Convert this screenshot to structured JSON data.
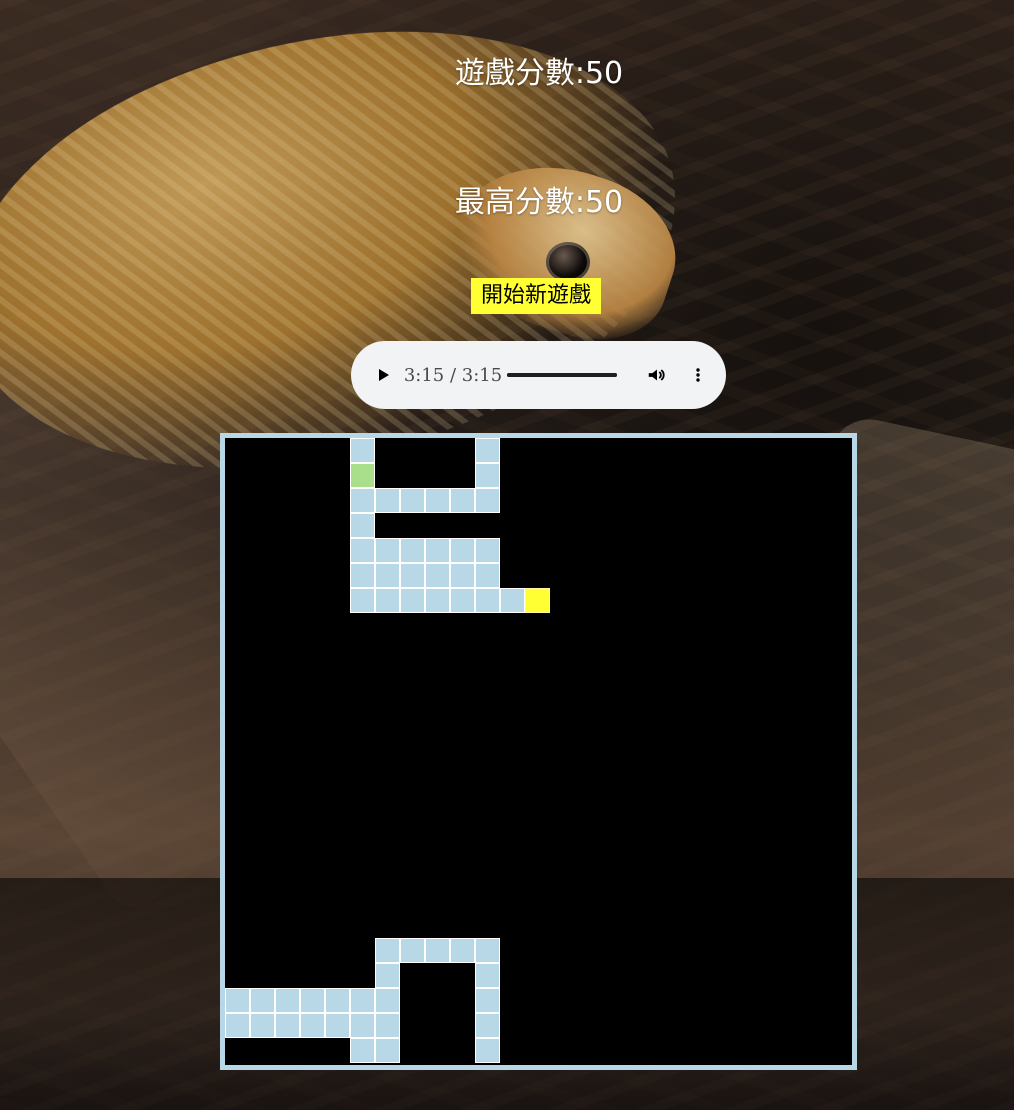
{
  "header": {
    "game_score_text": "遊戲分數:50",
    "high_score_text": "最高分數:50"
  },
  "controls": {
    "new_game_label": "開始新遊戲"
  },
  "audio": {
    "time_text": "3:15 / 3:15",
    "progress_ratio": 1,
    "icons": {
      "play": "play-icon",
      "volume": "volume-icon",
      "more": "more-vertical-icon"
    }
  },
  "game": {
    "grid": {
      "cols": 25,
      "rows": 25
    },
    "snake_cells": [
      [
        5,
        0
      ],
      [
        5,
        1
      ],
      [
        5,
        2
      ],
      [
        5,
        3
      ],
      [
        5,
        4
      ],
      [
        5,
        5
      ],
      [
        5,
        6
      ],
      [
        6,
        2
      ],
      [
        7,
        2
      ],
      [
        8,
        2
      ],
      [
        9,
        2
      ],
      [
        10,
        0
      ],
      [
        10,
        1
      ],
      [
        10,
        2
      ],
      [
        6,
        4
      ],
      [
        7,
        4
      ],
      [
        8,
        4
      ],
      [
        9,
        4
      ],
      [
        10,
        4
      ],
      [
        6,
        5
      ],
      [
        7,
        5
      ],
      [
        8,
        5
      ],
      [
        9,
        5
      ],
      [
        10,
        5
      ],
      [
        6,
        6
      ],
      [
        7,
        6
      ],
      [
        8,
        6
      ],
      [
        9,
        6
      ],
      [
        10,
        6
      ],
      [
        11,
        6
      ],
      [
        0,
        22
      ],
      [
        1,
        22
      ],
      [
        2,
        22
      ],
      [
        3,
        22
      ],
      [
        4,
        22
      ],
      [
        5,
        22
      ],
      [
        0,
        23
      ],
      [
        1,
        23
      ],
      [
        2,
        23
      ],
      [
        3,
        23
      ],
      [
        4,
        23
      ],
      [
        5,
        23
      ],
      [
        5,
        24
      ],
      [
        6,
        20
      ],
      [
        6,
        21
      ],
      [
        6,
        22
      ],
      [
        6,
        23
      ],
      [
        6,
        24
      ],
      [
        7,
        20
      ],
      [
        8,
        20
      ],
      [
        9,
        20
      ],
      [
        10,
        20
      ],
      [
        10,
        21
      ],
      [
        10,
        22
      ],
      [
        10,
        23
      ],
      [
        10,
        24
      ]
    ],
    "head_cell": [
      5,
      1
    ],
    "food_cell": [
      12,
      6
    ],
    "colors": {
      "board_background": "#000000",
      "border": "#b7d7e6",
      "snake": "#b8d8e8",
      "head": "#a9de8a",
      "food": "#ffff33",
      "button": "#ffff33",
      "audio_background": "#f1f3f4"
    }
  }
}
